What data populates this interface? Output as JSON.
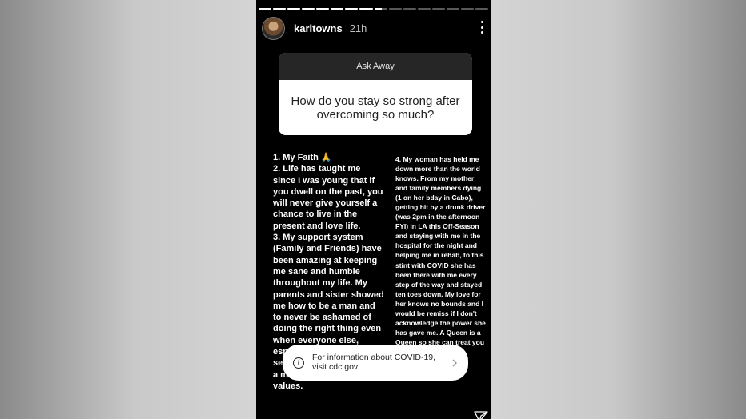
{
  "story": {
    "progress": [
      1,
      1,
      1,
      1,
      1,
      1,
      1,
      1,
      0.6,
      0,
      0,
      0,
      0,
      0,
      0,
      0
    ],
    "user": {
      "name": "karltowns",
      "time": "21h"
    },
    "question": {
      "header": "Ask Away",
      "text": "How do you stay so strong after overcoming so much?"
    },
    "answer_left": [
      "1. My Faith 🙏",
      "2. Life has taught me since I was young that if you dwell on the past, you will never give yourself a chance to live in the present and love life.",
      "3. My support system (Family and Friends) have been amazing at keeping me sane and humble throughout my life. My parents and sister showed me how to be a man and to never be ashamed of doing the right thing even when everyone else, especially society, make it seem it's not \"cool\" to be a man of morals and values."
    ],
    "answer_right": [
      "4. My woman has held me down more than the world knows. From my mother and family members dying (1 on her bday in Cabo), getting hit by a drunk driver (was 2pm in the afternoon FYI) in LA this Off-Season and staying with me in the hospital for the night and helping me in rehab, to this stint with COVID she has been there with me every step of the way and stayed ten toes down. My love for her knows no bounds and I would be remiss if I don't acknowledge the power she has gave me. A Queen is a Queen so she can treat you like a King."
    ],
    "covid_notice": "For information about COVID-19, visit cdc.gov."
  }
}
